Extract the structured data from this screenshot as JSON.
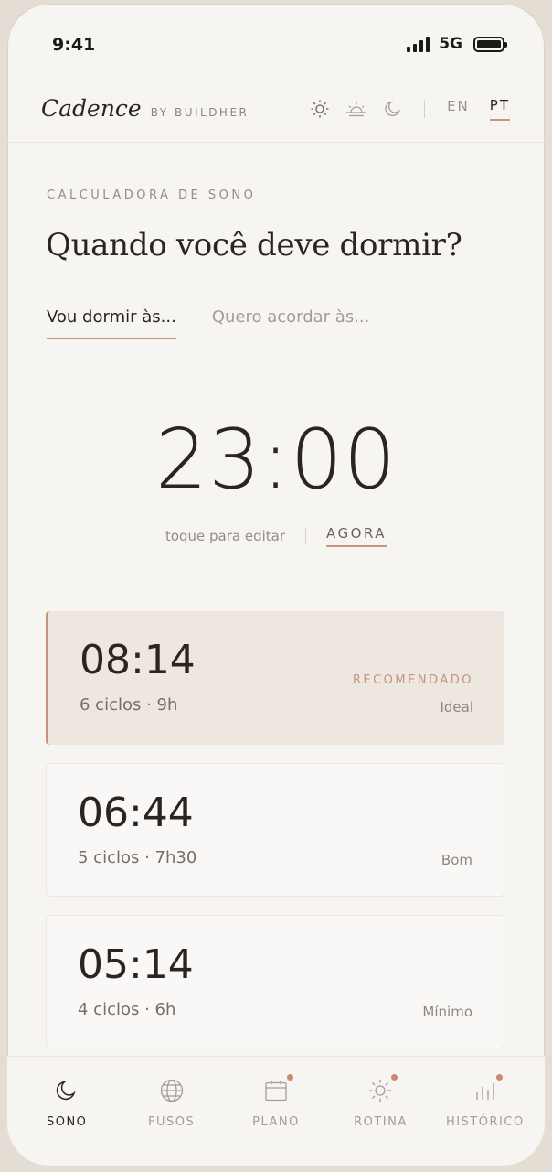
{
  "status_bar": {
    "time": "9:41",
    "network": "5G"
  },
  "header": {
    "brand_name": "Cadence",
    "brand_sub": "BY BUILDHER",
    "theme_icons": [
      "sun-icon",
      "sunset-icon",
      "moon-icon"
    ],
    "languages": [
      "EN",
      "PT"
    ],
    "active_language": "PT"
  },
  "section": {
    "eyebrow": "CALCULADORA DE SONO",
    "title": "Quando você deve dormir?"
  },
  "tabs": [
    {
      "label": "Vou dormir às...",
      "active": true
    },
    {
      "label": "Quero acordar às...",
      "active": false
    }
  ],
  "time_picker": {
    "value": "23:00",
    "hint": "toque para editar",
    "now_label": "AGORA"
  },
  "results": [
    {
      "time": "08:14",
      "meta": "6 ciclos · 9h",
      "badge": "RECOMENDADO",
      "quality": "Ideal",
      "recommended": true
    },
    {
      "time": "06:44",
      "meta": "5 ciclos · 7h30",
      "quality": "Bom",
      "recommended": false
    },
    {
      "time": "05:14",
      "meta": "4 ciclos · 6h",
      "quality": "Mínimo",
      "recommended": false
    }
  ],
  "bottom_nav": [
    {
      "label": "SONO",
      "icon": "moon-icon",
      "active": true,
      "dot": false
    },
    {
      "label": "FUSOS",
      "icon": "globe-icon",
      "active": false,
      "dot": false
    },
    {
      "label": "PLANO",
      "icon": "calendar-icon",
      "active": false,
      "dot": true
    },
    {
      "label": "ROTINA",
      "icon": "sun-icon",
      "active": false,
      "dot": true
    },
    {
      "label": "HISTÓRICO",
      "icon": "bar-chart-icon",
      "active": false,
      "dot": true
    }
  ],
  "colors": {
    "accent": "#c4967c",
    "dot": "#c98a72",
    "background": "#f7f5f2",
    "recommended_card": "#ede7df"
  }
}
